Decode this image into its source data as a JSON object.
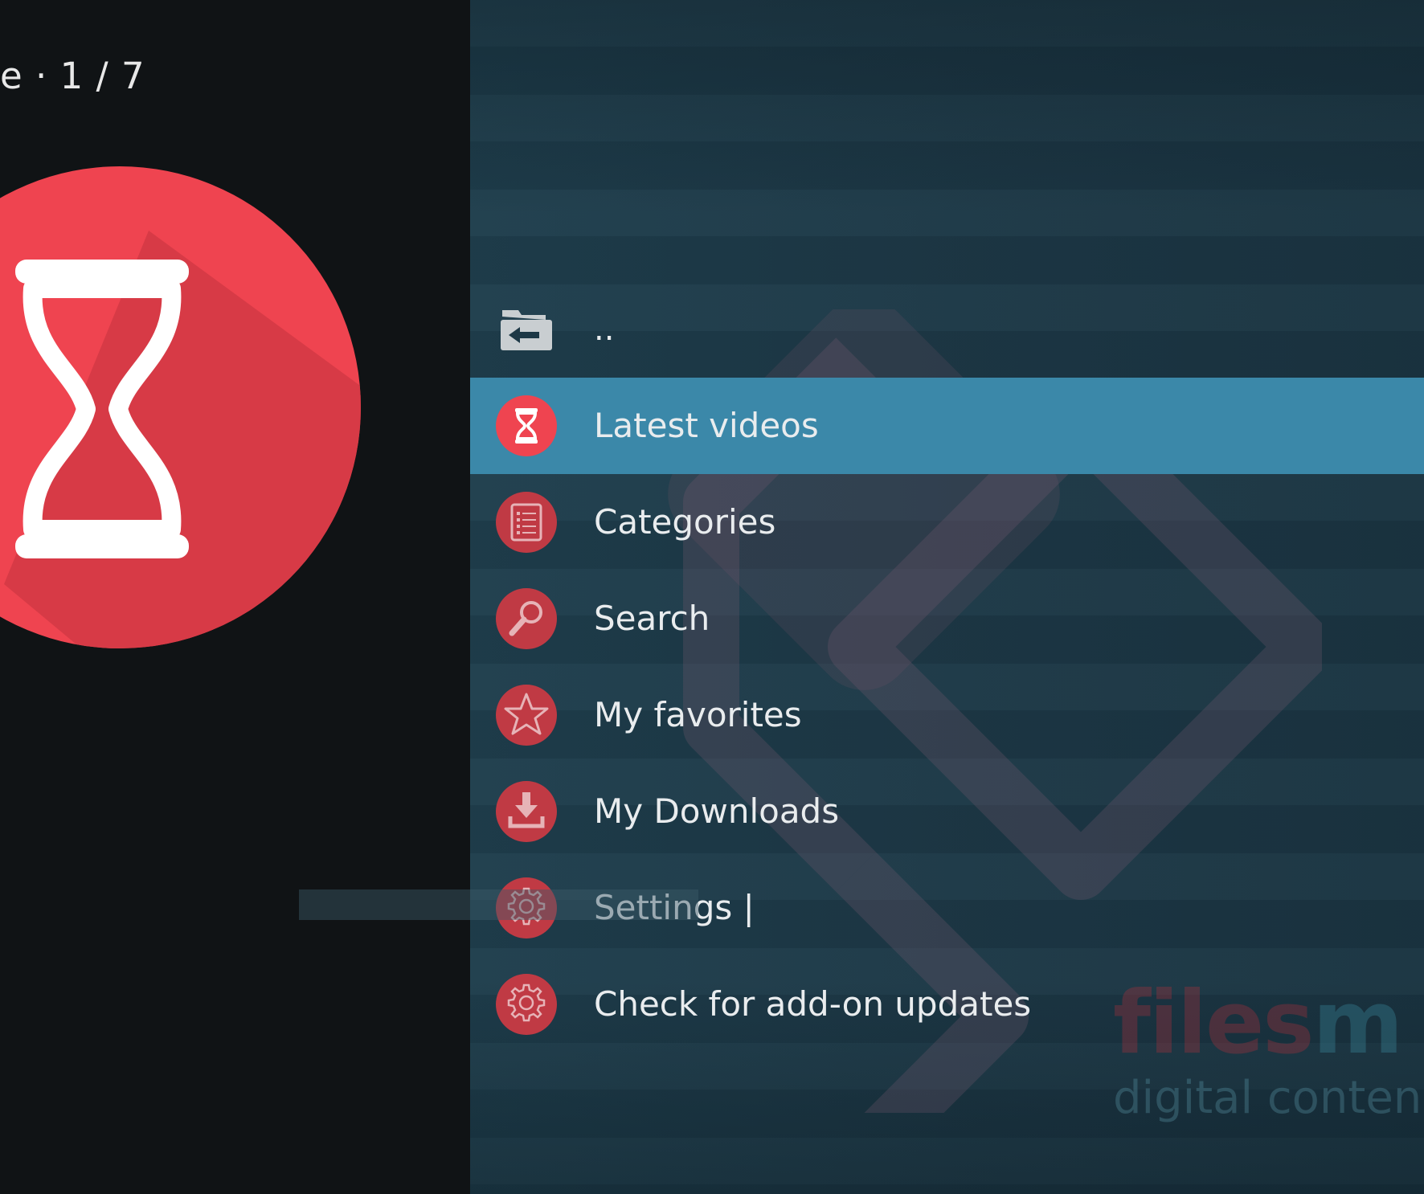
{
  "header": {
    "page_counter": "e · 1 / 7"
  },
  "colors": {
    "accent_selected": "#3b88a9",
    "icon_red": "#e8454f",
    "icon_red_dark": "#c03a44",
    "panel_left": "#101315",
    "panel_right": "#1d3846"
  },
  "preview": {
    "icon": "hourglass-icon"
  },
  "list": {
    "items": [
      {
        "label": "..",
        "icon": "folder-back-icon"
      },
      {
        "label": "Latest videos",
        "icon": "hourglass-icon",
        "selected": true
      },
      {
        "label": "Categories",
        "icon": "list-icon"
      },
      {
        "label": "Search",
        "icon": "search-icon"
      },
      {
        "label": "My favorites",
        "icon": "star-icon"
      },
      {
        "label": "My Downloads",
        "icon": "download-icon"
      },
      {
        "label": "Settings |",
        "icon": "gear-icon"
      },
      {
        "label": "Check for add-on updates",
        "icon": "gear-icon"
      }
    ]
  },
  "watermark": {
    "brand_a": "files",
    "brand_b": "m",
    "subtitle": "digital conten"
  }
}
